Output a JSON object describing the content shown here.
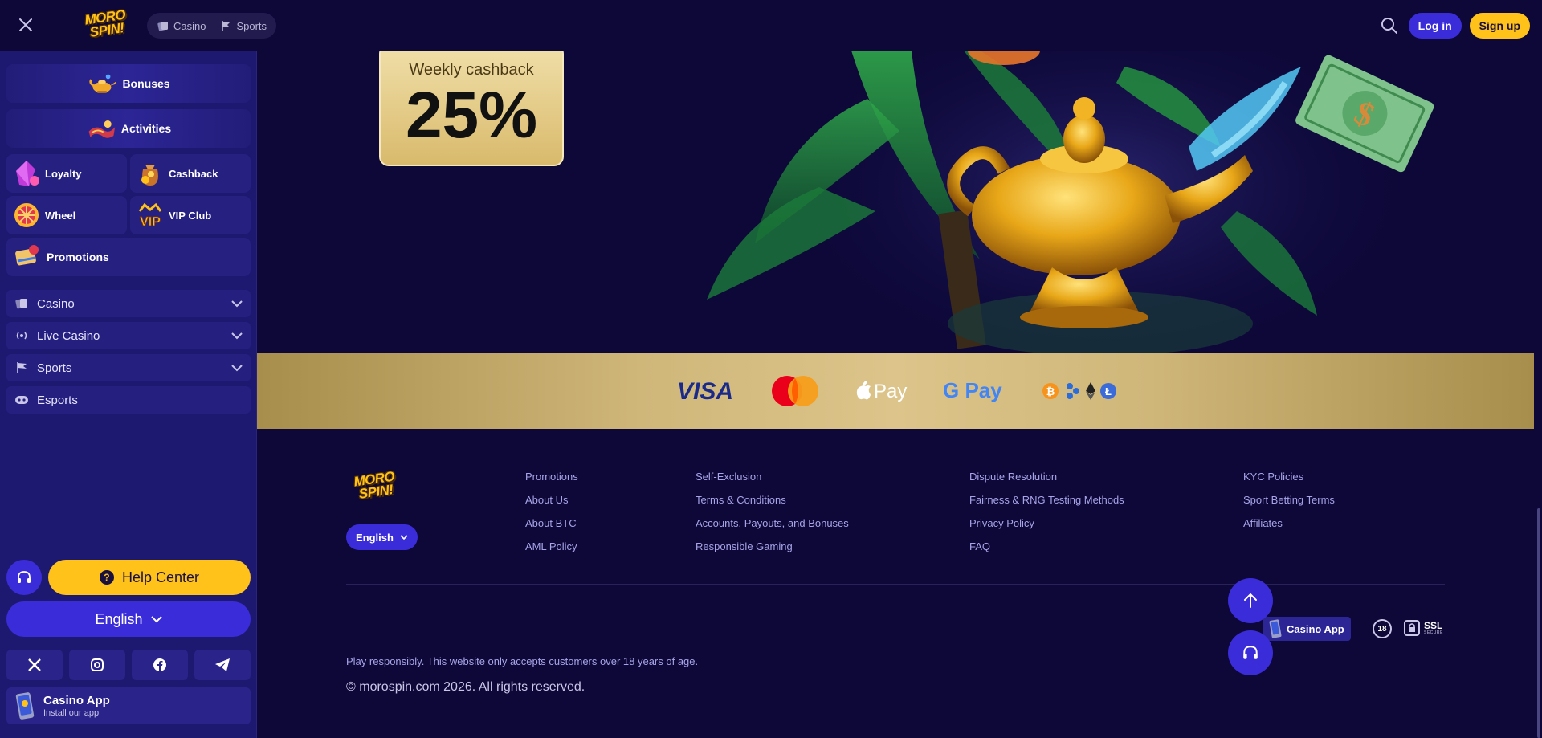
{
  "header": {
    "logo_text": "MORO SPIN!",
    "tabs": [
      {
        "label": "Casino",
        "icon": "casino-cards-icon"
      },
      {
        "label": "Sports",
        "icon": "sports-flag-icon"
      }
    ],
    "login_label": "Log in",
    "signup_label": "Sign up"
  },
  "sidebar": {
    "promo_items": [
      {
        "label": "Bonuses",
        "icon": "genie-lamp-icon"
      },
      {
        "label": "Activities",
        "icon": "magic-carpet-icon"
      },
      {
        "label": "Loyalty",
        "icon": "crystal-icon"
      },
      {
        "label": "Cashback",
        "icon": "coin-bag-icon"
      },
      {
        "label": "Wheel",
        "icon": "fortune-wheel-icon"
      },
      {
        "label": "VIP Club",
        "icon": "vip-icon"
      },
      {
        "label": "Promotions",
        "icon": "scroll-icon"
      }
    ],
    "nav": [
      {
        "label": "Casino",
        "icon": "casino-cards-icon",
        "expandable": true
      },
      {
        "label": "Live Casino",
        "icon": "live-broadcast-icon",
        "expandable": true
      },
      {
        "label": "Sports",
        "icon": "sports-flag-icon",
        "expandable": true
      },
      {
        "label": "Esports",
        "icon": "gamepad-icon",
        "expandable": false
      }
    ],
    "help_label": "Help Center",
    "language_label": "English",
    "socials": [
      "x-icon",
      "instagram-icon",
      "facebook-icon",
      "telegram-icon"
    ],
    "app": {
      "title": "Casino App",
      "subtitle": "Install our app"
    }
  },
  "hero": {
    "cashback_label": "Weekly cashback",
    "cashback_value": "25%"
  },
  "payments": [
    "VISA",
    "Mastercard",
    "Pay",
    "G Pay",
    "crypto"
  ],
  "footer": {
    "language_label": "English",
    "columns": [
      [
        "Promotions",
        "About Us",
        "About BTC",
        "AML Policy"
      ],
      [
        "Self-Exclusion",
        "Terms & Conditions",
        "Accounts, Payouts, and Bonuses",
        "Responsible Gaming"
      ],
      [
        "Dispute Resolution",
        "Fairness & RNG Testing Methods",
        "Privacy Policy",
        "FAQ"
      ],
      [
        "KYC Policies",
        "Sport Betting Terms",
        "Affiliates"
      ]
    ],
    "app_badge": "Casino App",
    "age_badge": "18",
    "ssl_label": "SSL",
    "ssl_sub": "SECURE",
    "responsible_text": "Play responsibly. This website only accepts customers over 18 years of age.",
    "copyright": "© morospin.com 2026. All rights reserved."
  },
  "colors": {
    "background": "#0d0838",
    "sidebar": "#1e1970",
    "accent_blue": "#3a2cd9",
    "accent_yellow": "#ffc21a",
    "payments_gold": "#cfb679"
  }
}
